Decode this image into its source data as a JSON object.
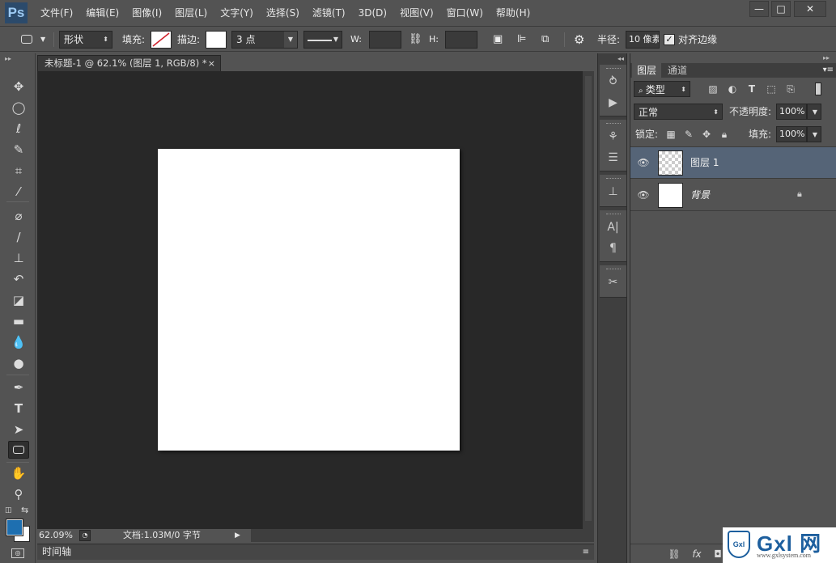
{
  "app": {
    "logo": "Ps"
  },
  "menu": [
    "文件(F)",
    "编辑(E)",
    "图像(I)",
    "图层(L)",
    "文字(Y)",
    "选择(S)",
    "滤镜(T)",
    "3D(D)",
    "视图(V)",
    "窗口(W)",
    "帮助(H)"
  ],
  "window_controls": {
    "minimize": "—",
    "maximize": "□",
    "close": "✕"
  },
  "options": {
    "mode": "形状",
    "fill_label": "填充:",
    "stroke_label": "描边:",
    "stroke_width": "3 点",
    "w_label": "W:",
    "h_label": "H:",
    "radius_label": "半径:",
    "radius_value": "10 像素",
    "align_edges": "对齐边缘",
    "align_checked": true
  },
  "document": {
    "tab_title": "未标题-1 @ 62.1% (图层 1, RGB/8) *",
    "tab_close": "×",
    "zoom": "62.09%",
    "doc_info": "文档:1.03M/0 字节"
  },
  "timeline": {
    "label": "时间轴"
  },
  "panels": {
    "tabs": [
      "图层",
      "通道"
    ],
    "filter_kind": "类型",
    "blend_mode": "正常",
    "opacity_label": "不透明度:",
    "opacity_value": "100%",
    "lock_label": "锁定:",
    "fill_label": "填充:",
    "fill_value": "100%"
  },
  "layers": [
    {
      "name": "图层 1",
      "selected": true,
      "transparent": true,
      "locked": false
    },
    {
      "name": "背景",
      "selected": false,
      "transparent": false,
      "locked": true
    }
  ],
  "colors": {
    "foreground": "#1e6fb0",
    "background": "#ffffff",
    "selected_layer": "#556477"
  },
  "watermark": {
    "brand": "Gxl 网",
    "shield": "Gxl",
    "url": "www.gxlsystem.com"
  }
}
